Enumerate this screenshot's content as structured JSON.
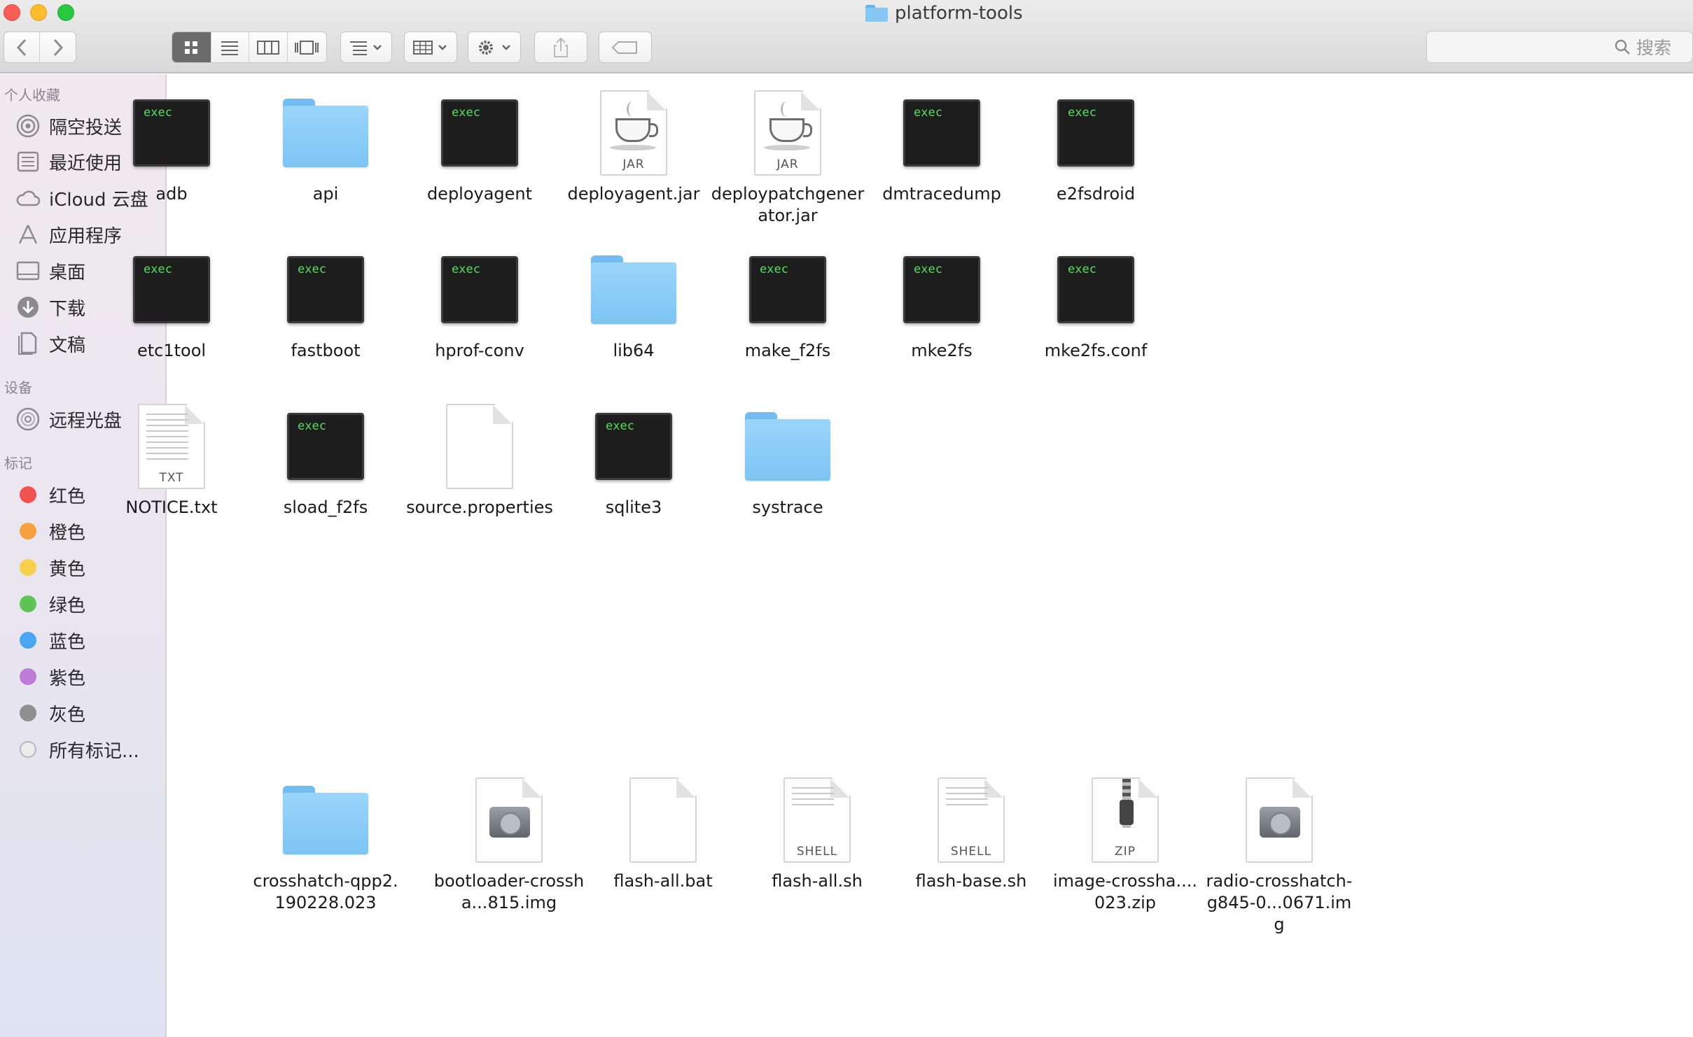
{
  "window": {
    "title": "platform-tools"
  },
  "toolbar": {
    "search_placeholder": "搜索"
  },
  "sidebar": {
    "favorites_header": "个人收藏",
    "favorites": [
      {
        "label": "隔空投送",
        "icon": "airdrop-icon"
      },
      {
        "label": "最近使用",
        "icon": "recents-icon"
      },
      {
        "label": "iCloud 云盘",
        "icon": "cloud-icon"
      },
      {
        "label": "应用程序",
        "icon": "applications-icon"
      },
      {
        "label": "桌面",
        "icon": "desktop-icon"
      },
      {
        "label": "下载",
        "icon": "download-icon"
      },
      {
        "label": "文稿",
        "icon": "documents-icon"
      }
    ],
    "devices_header": "设备",
    "devices": [
      {
        "label": "远程光盘",
        "icon": "disc-icon"
      }
    ],
    "tags_header": "标记",
    "tags": [
      {
        "label": "红色",
        "color": "#f0534f"
      },
      {
        "label": "橙色",
        "color": "#f7a03e"
      },
      {
        "label": "黄色",
        "color": "#f7d04a"
      },
      {
        "label": "绿色",
        "color": "#5ec455"
      },
      {
        "label": "蓝色",
        "color": "#4aa6f0"
      },
      {
        "label": "紫色",
        "color": "#c07ad8"
      },
      {
        "label": "灰色",
        "color": "#8f8f8f"
      },
      {
        "label": "所有标记...",
        "color": "#cfcfcf"
      }
    ]
  },
  "files": [
    {
      "name": "adb",
      "kind": "exec",
      "badge": "exec"
    },
    {
      "name": "api",
      "kind": "folder"
    },
    {
      "name": "deployagent",
      "kind": "exec",
      "badge": "exec"
    },
    {
      "name": "deployagent.jar",
      "kind": "jar",
      "badge": "JAR"
    },
    {
      "name": "deploypatchgenerator.jar",
      "kind": "jar",
      "badge": "JAR"
    },
    {
      "name": "dmtracedump",
      "kind": "exec",
      "badge": "exec"
    },
    {
      "name": "e2fsdroid",
      "kind": "exec",
      "badge": "exec"
    },
    {
      "name": "etc1tool",
      "kind": "exec",
      "badge": "exec"
    },
    {
      "name": "fastboot",
      "kind": "exec",
      "badge": "exec"
    },
    {
      "name": "hprof-conv",
      "kind": "exec",
      "badge": "exec"
    },
    {
      "name": "lib64",
      "kind": "folder"
    },
    {
      "name": "make_f2fs",
      "kind": "exec",
      "badge": "exec"
    },
    {
      "name": "mke2fs",
      "kind": "exec",
      "badge": "exec"
    },
    {
      "name": "mke2fs.conf",
      "kind": "exec",
      "badge": "exec"
    },
    {
      "name": "NOTICE.txt",
      "kind": "text",
      "badge": "TXT"
    },
    {
      "name": "sload_f2fs",
      "kind": "exec",
      "badge": "exec"
    },
    {
      "name": "source.properties",
      "kind": "blank"
    },
    {
      "name": "sqlite3",
      "kind": "exec",
      "badge": "exec"
    },
    {
      "name": "systrace",
      "kind": "folder"
    },
    {
      "name": "crosshatch-qpp2.190228.023",
      "kind": "folder"
    },
    {
      "name": "bootloader-crossha...815.img",
      "kind": "disk"
    },
    {
      "name": "flash-all.bat",
      "kind": "blank"
    },
    {
      "name": "flash-all.sh",
      "kind": "shell",
      "badge": "SHELL"
    },
    {
      "name": "flash-base.sh",
      "kind": "shell",
      "badge": "SHELL"
    },
    {
      "name": "image-crossha....023.zip",
      "kind": "zip",
      "badge": "ZIP"
    },
    {
      "name": "radio-crosshatch-g845-0...0671.img",
      "kind": "disk"
    }
  ],
  "colors": {
    "folder": "#86c8f5",
    "exec_text": "#52e05a",
    "selected_view": "#6b6b6b"
  }
}
